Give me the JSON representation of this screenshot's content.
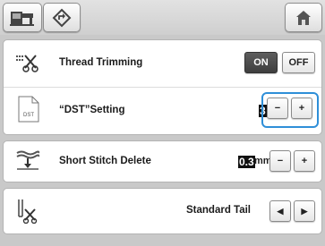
{
  "toolbar": {
    "machine_button_icon": "machine-icon",
    "settings_button_icon": "diamond-arrow-icon",
    "home_button_icon": "home-icon"
  },
  "settings": {
    "thread_trimming": {
      "label": "Thread Trimming",
      "on_label": "ON",
      "off_label": "OFF",
      "selected": "ON"
    },
    "dst_setting": {
      "label": "“DST”Setting",
      "file_label": "DST",
      "value": "3",
      "minus": "−",
      "plus": "+"
    },
    "short_stitch_delete": {
      "label": "Short Stitch Delete",
      "value": "0.3",
      "unit": "mm",
      "minus": "−",
      "plus": "+"
    },
    "tail_setting": {
      "value_label": "Standard Tail",
      "left_arrow": "◀",
      "right_arrow": "▶"
    }
  },
  "colors": {
    "highlight": "#2f8fd8",
    "on_button": "#4a4a4a"
  }
}
